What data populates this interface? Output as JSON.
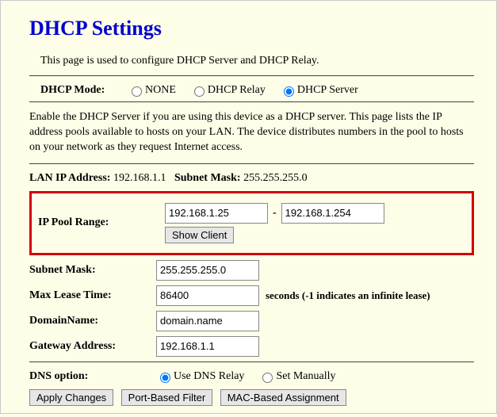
{
  "title": "DHCP Settings",
  "intro": "This page is used to configure DHCP Server and DHCP Relay.",
  "mode": {
    "label": "DHCP Mode:",
    "options": {
      "none": "NONE",
      "relay": "DHCP Relay",
      "server": "DHCP Server"
    },
    "selected": "server"
  },
  "desc": "Enable the DHCP Server if you are using this device as a DHCP server. This page lists the IP address pools available to hosts on your LAN. The device distributes numbers in the pool to hosts on your network as they request Internet access.",
  "info": {
    "lan_label": "LAN IP Address:",
    "lan_ip": "192.168.1.1",
    "subnet_label": "Subnet Mask:",
    "subnet": "255.255.255.0"
  },
  "pool": {
    "label": "IP Pool Range:",
    "start": "192.168.1.25",
    "end": "192.168.1.254",
    "show_client": "Show Client"
  },
  "fields": {
    "subnet_label": "Subnet Mask:",
    "subnet": "255.255.255.0",
    "lease_label": "Max Lease Time:",
    "lease": "86400",
    "lease_after": "seconds (-1 indicates an infinite lease)",
    "domain_label": "DomainName:",
    "domain": "domain.name",
    "gw_label": "Gateway Address:",
    "gw": "192.168.1.1"
  },
  "dns": {
    "label": "DNS option:",
    "relay": "Use DNS Relay",
    "manual": "Set Manually",
    "selected": "relay"
  },
  "buttons": {
    "apply": "Apply Changes",
    "port": "Port-Based Filter",
    "mac": "MAC-Based Assignment"
  }
}
